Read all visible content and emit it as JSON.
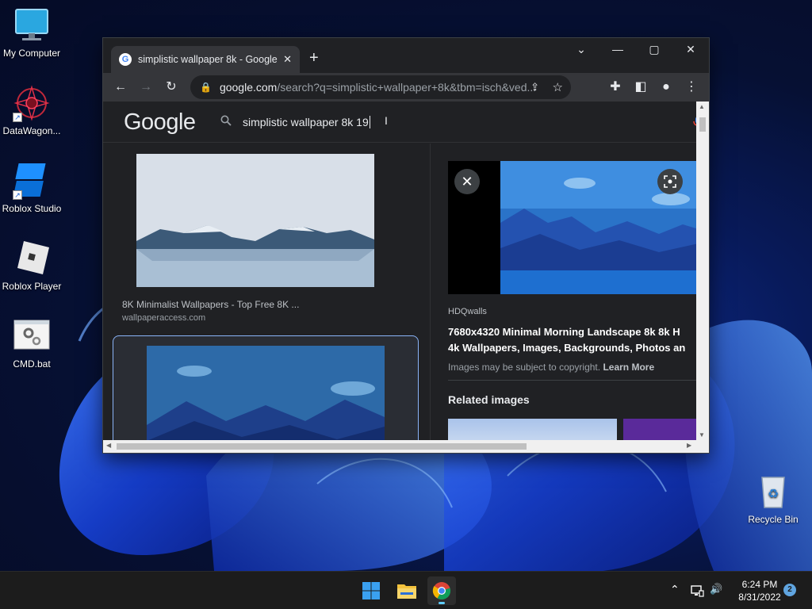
{
  "desktop": {
    "icons": [
      {
        "label": "My Computer",
        "icon": "monitor-icon"
      },
      {
        "label": "DataWagon...",
        "icon": "mandala-icon"
      },
      {
        "label": "Roblox Studio",
        "icon": "roblox-studio-icon"
      },
      {
        "label": "Roblox Player",
        "icon": "roblox-player-icon"
      },
      {
        "label": "CMD.bat",
        "icon": "batch-file-icon"
      },
      {
        "label": "Recycle Bin",
        "icon": "recycle-bin-icon"
      }
    ]
  },
  "browser": {
    "tab_title": "simplistic wallpaper 8k - Google",
    "tab_close": "✕",
    "new_tab": "+",
    "window_controls": {
      "tabs_menu": "⌄",
      "minimize": "—",
      "maximize": "▢",
      "close": "✕"
    },
    "url_host": "google.com",
    "url_path": "/search?q=simplistic+wallpaper+8k&tbm=isch&ved...",
    "nav": {
      "back": "←",
      "forward": "→",
      "reload": "↻"
    },
    "toolbar_icons": {
      "share": "⇪",
      "bookmark": "☆",
      "extensions": "✚",
      "side_panel": "◧",
      "profile": "●",
      "menu": "⋮"
    }
  },
  "google": {
    "logo": "Google",
    "search_query": "simplistic wallpaper 8k 19",
    "results": [
      {
        "title": "8K Minimalist Wallpapers - Top Free 8K ...",
        "source": "wallpaperaccess.com"
      }
    ],
    "preview": {
      "source": "HDQwalls",
      "title_line1": "7680x4320 Minimal Morning Landscape 8k 8k H",
      "title_line2": "4k Wallpapers, Images, Backgrounds, Photos an",
      "copyright": "Images may be subject to copyright.",
      "learn_more": "Learn More",
      "related": "Related images",
      "close": "✕"
    }
  },
  "taskbar": {
    "time": "6:24 PM",
    "date": "8/31/2022",
    "notifications": "2",
    "tray_chevron": "⌃",
    "volume": "🔊"
  },
  "colors": {
    "chrome_dark": "#202124",
    "chrome_toolbar": "#35363a",
    "accent_blue": "#8ab4f8",
    "taskbar": "#1c1c1c"
  }
}
